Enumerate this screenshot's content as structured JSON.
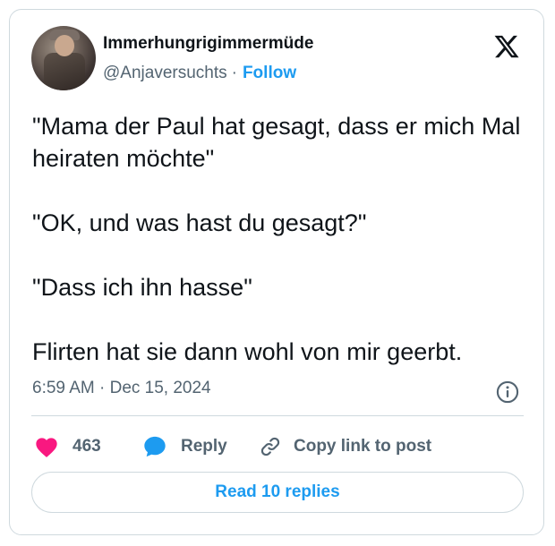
{
  "author": {
    "display_name": "Immerhungrigimmermüde",
    "handle": "@Anjaversuchts",
    "separator": "·",
    "follow_label": "Follow"
  },
  "post": {
    "paragraphs": [
      "\"Mama der Paul hat gesagt, dass er mich Mal heiraten möchte\"",
      "\"OK, und was hast du gesagt?\"",
      "\"Dass ich ihn hasse\"",
      "Flirten hat sie dann wohl von mir geerbt."
    ],
    "timestamp": "6:59 AM · Dec 15, 2024"
  },
  "actions": {
    "like_count": "463",
    "reply_label": "Reply",
    "copy_label": "Copy link to post"
  },
  "read_replies_label": "Read 10 replies",
  "icons": {
    "logo": "x-logo-icon",
    "info": "info-icon",
    "like": "heart-icon",
    "reply": "speech-bubble-icon",
    "copy": "link-icon"
  },
  "colors": {
    "accent": "#1d9bf0",
    "like": "#f91880",
    "secondary_text": "#536471",
    "border": "#cfd9de"
  }
}
